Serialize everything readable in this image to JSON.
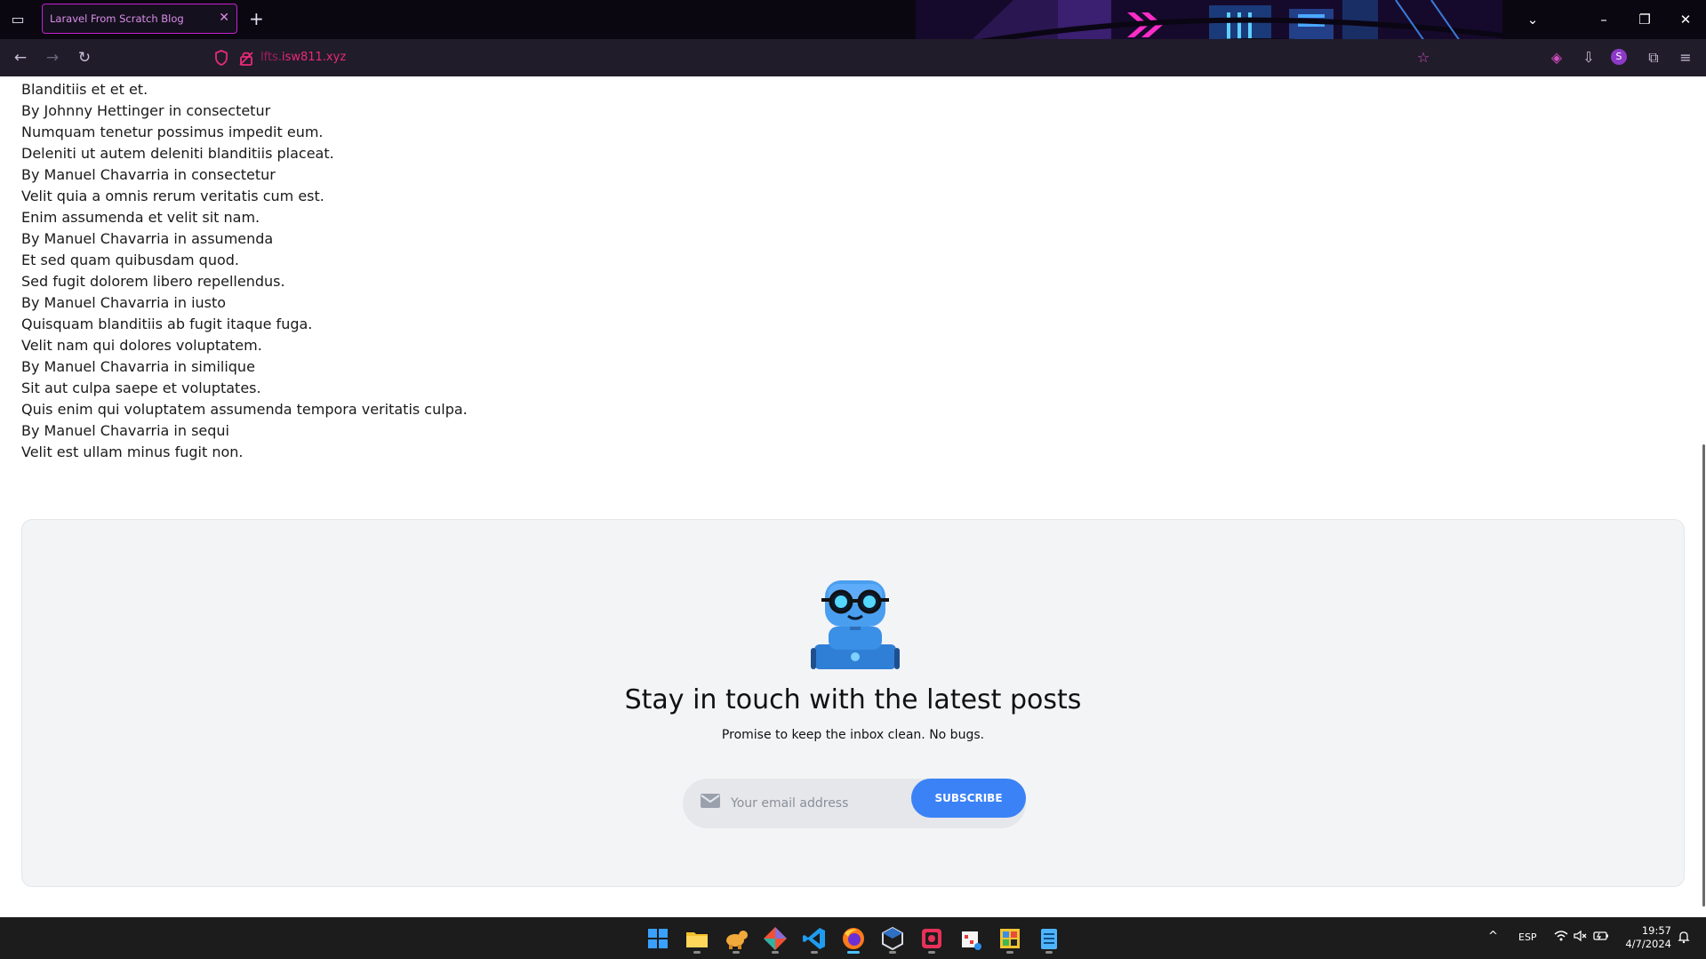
{
  "browser": {
    "tab_title": "Laravel From Scratch Blog",
    "url_subdomain": "lfts.",
    "url_domain": "isw811.xyz"
  },
  "posts": [
    "Blanditiis et et et.",
    "By Johnny Hettinger in consectetur",
    "Numquam tenetur possimus impedit eum.",
    "Deleniti ut autem deleniti blanditiis placeat.",
    "By Manuel Chavarria in consectetur",
    "Velit quia a omnis rerum veritatis cum est.",
    "Enim assumenda et velit sit nam.",
    "By Manuel Chavarria in assumenda",
    "Et sed quam quibusdam quod.",
    "Sed fugit dolorem libero repellendus.",
    "By Manuel Chavarria in iusto",
    "Quisquam blanditiis ab fugit itaque fuga.",
    "Velit nam qui dolores voluptatem.",
    "By Manuel Chavarria in similique",
    "Sit aut culpa saepe et voluptates.",
    "Quis enim qui voluptatem assumenda tempora veritatis culpa.",
    "By Manuel Chavarria in sequi",
    "Velit est ullam minus fugit non."
  ],
  "newsletter": {
    "title": "Stay in touch with the latest posts",
    "subtitle": "Promise to keep the inbox clean. No bugs.",
    "email_placeholder": "Your email address",
    "subscribe_label": "SUBSCRIBE",
    "accent_color": "#3b82f6"
  },
  "taskbar": {
    "apps": [
      "start-icon",
      "file-explorer-icon",
      "app-icon",
      "git-icon",
      "vscode-icon",
      "firefox-icon",
      "virtualbox-icon",
      "app-icon",
      "app-icon",
      "app-icon",
      "notepad-icon"
    ],
    "language": "ESP",
    "time": "19:57",
    "date": "4/7/2024"
  }
}
